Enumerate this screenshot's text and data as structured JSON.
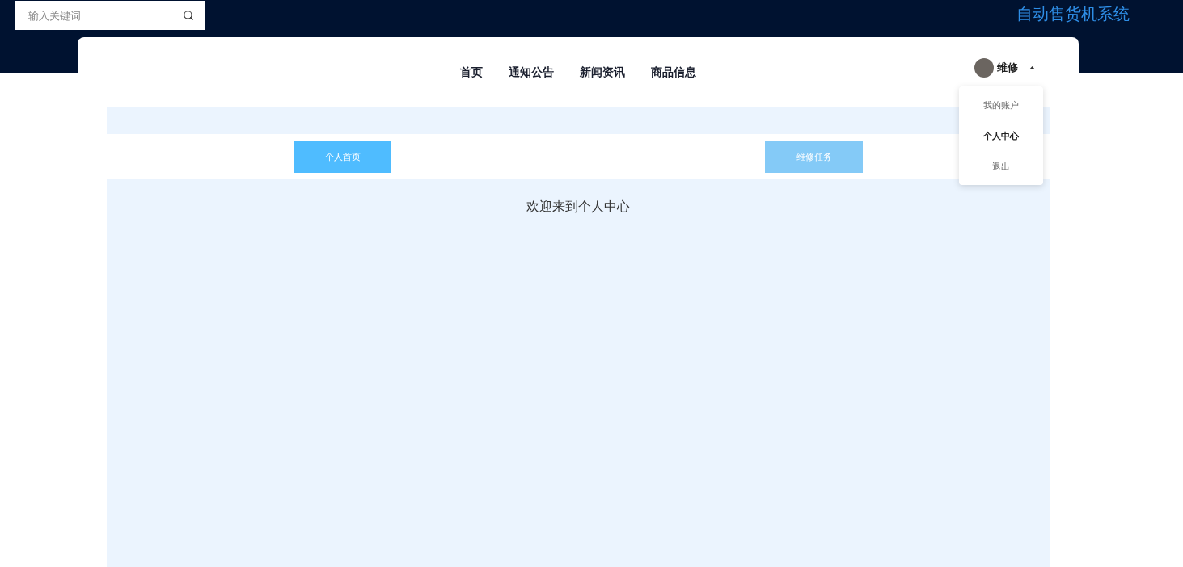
{
  "search": {
    "placeholder": "输入关键词"
  },
  "site_title": "自动售货机系统",
  "nav": [
    {
      "label": "首页"
    },
    {
      "label": "通知公告"
    },
    {
      "label": "新闻资讯"
    },
    {
      "label": "商品信息"
    }
  ],
  "user": {
    "name": "维修",
    "menu_open": true
  },
  "user_menu": [
    {
      "label": "我的账户",
      "selected": false
    },
    {
      "label": "个人中心",
      "selected": true
    },
    {
      "label": "退出",
      "selected": false
    }
  ],
  "tabs": [
    {
      "label": "个人首页",
      "selected": true
    },
    {
      "label": "维修任务",
      "selected": false
    }
  ],
  "welcome": "欢迎来到个人中心"
}
